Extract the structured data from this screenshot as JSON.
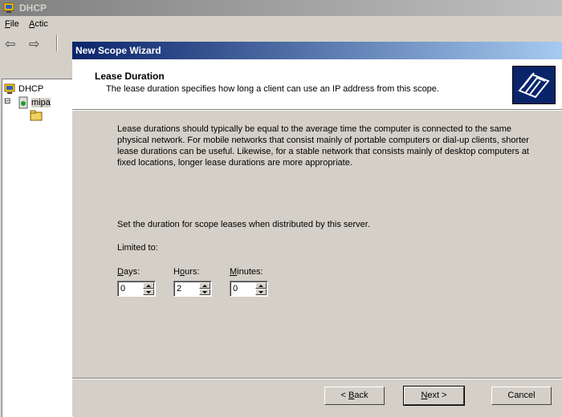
{
  "background_window": {
    "title": "DHCP",
    "menu": [
      "File",
      "Actic"
    ],
    "tree": {
      "root": "DHCP",
      "server": "mipa"
    }
  },
  "wizard": {
    "title": "New Scope Wizard",
    "header": {
      "title": "Lease Duration",
      "subtitle": "The lease duration specifies how long a client can use an IP address from this scope."
    },
    "body_text": "Lease durations should typically be equal to the average time the computer is connected to the same physical network. For mobile networks that consist mainly of portable computers or dial-up clients, shorter lease durations can be useful. Likewise, for a stable network that consists mainly of desktop computers at fixed locations, longer lease durations are more appropriate.",
    "set_duration_text": "Set the duration for scope leases when distributed by this server.",
    "limited_to_label": "Limited to:",
    "fields": {
      "days": {
        "label_prefix": "",
        "label_accel": "D",
        "label_rest": "ays:",
        "value": "0"
      },
      "hours": {
        "label_prefix": "H",
        "label_accel": "o",
        "label_rest": "urs:",
        "value": "2"
      },
      "minutes": {
        "label_prefix": "",
        "label_accel": "M",
        "label_rest": "inutes:",
        "value": "0"
      }
    },
    "buttons": {
      "back": {
        "prefix": "< ",
        "accel": "B",
        "rest": "ack"
      },
      "next": {
        "prefix": "",
        "accel": "N",
        "rest": "ext >"
      },
      "cancel": "Cancel"
    }
  },
  "colors": {
    "wizard_title_gradient_start": "#0a246a",
    "wizard_title_gradient_end": "#a6caf0",
    "dialog_face": "#d4d0c8"
  }
}
